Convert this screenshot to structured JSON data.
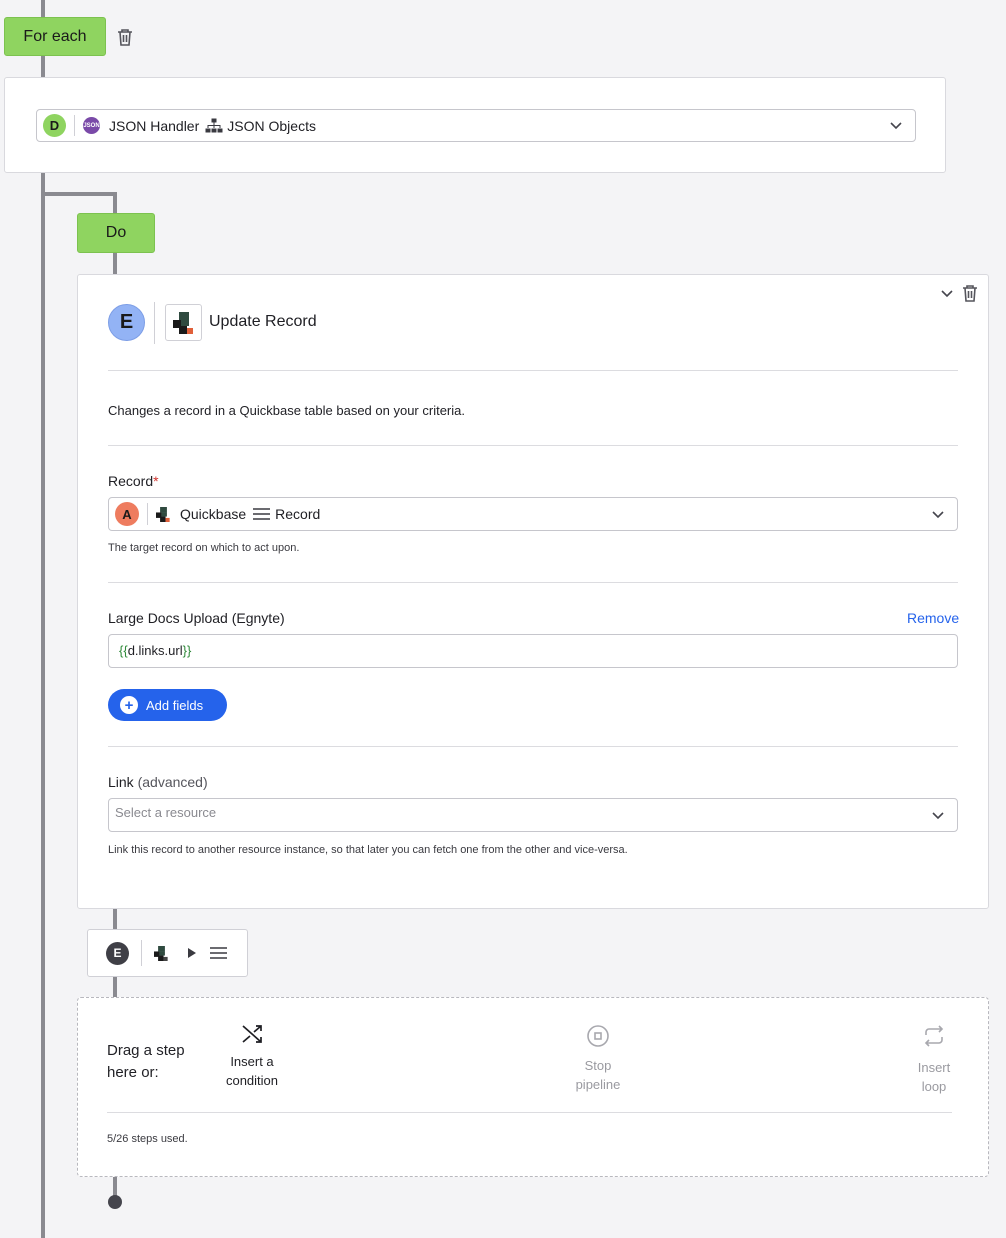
{
  "foreach": {
    "label": "For each",
    "source": {
      "badge": "D",
      "app": "JSON Handler",
      "resource": "JSON Objects"
    }
  },
  "do": {
    "label": "Do"
  },
  "step": {
    "badge": "E",
    "title": "Update Record",
    "description": "Changes a record in a Quickbase table based on your criteria.",
    "record": {
      "label": "Record",
      "required_mark": "*",
      "badge": "A",
      "app": "Quickbase",
      "resource": "Record",
      "help": "The target record on which to act upon."
    },
    "field": {
      "label": "Large Docs Upload (Egnyte)",
      "remove": "Remove",
      "open": "{{",
      "value": "d.links.url",
      "close": "}}"
    },
    "add_fields": "Add fields",
    "link": {
      "label": "Link",
      "label_suffix": "(advanced)",
      "placeholder": "Select a resource",
      "help": "Link this record to another resource instance, so that later you can fetch one from the other and vice-versa."
    }
  },
  "mini": {
    "badge": "E"
  },
  "dropzone": {
    "title_line1": "Drag a step",
    "title_line2": "here or:",
    "insert_condition": [
      "Insert a",
      "condition"
    ],
    "stop_pipeline": [
      "Stop",
      "pipeline"
    ],
    "insert_loop": [
      "Insert",
      "loop"
    ],
    "steps_used": "5/26 steps used."
  },
  "colors": {
    "pill_green": "#8fd460",
    "badge_d": "#8fd460",
    "badge_e": "#93b3f5",
    "badge_a": "#ee7c5f",
    "primary_blue": "#2563eb",
    "connector": "#8a8a90"
  }
}
